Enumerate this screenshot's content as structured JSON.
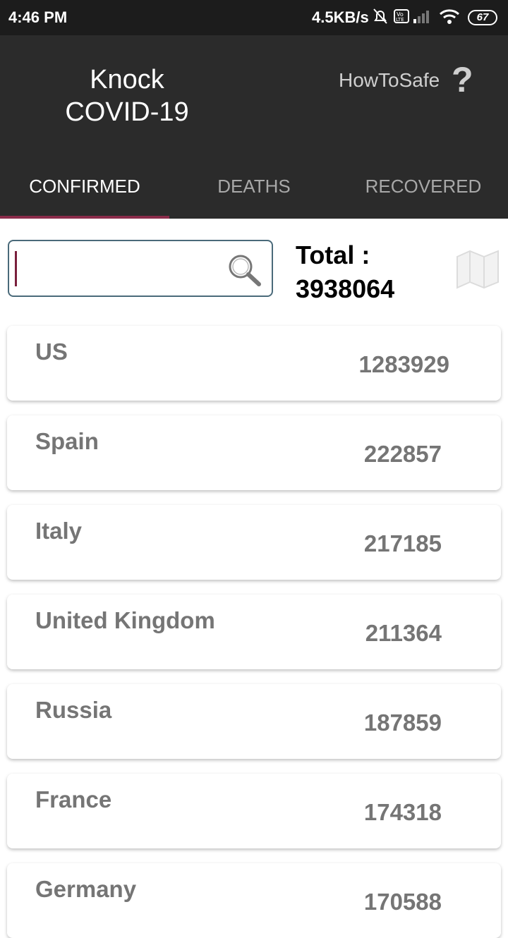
{
  "status_bar": {
    "time": "4:46 PM",
    "net_speed": "4.5KB/s",
    "battery": "67",
    "icons": [
      "mute-icon",
      "volte-icon",
      "signal-icon",
      "wifi-icon",
      "battery-icon"
    ]
  },
  "header": {
    "title_line1": "Knock",
    "title_line2": "COVID-19",
    "howto_label": "HowToSafe",
    "help_symbol": "?"
  },
  "tabs": [
    {
      "label": "CONFIRMED",
      "active": true
    },
    {
      "label": "DEATHS",
      "active": false
    },
    {
      "label": "RECOVERED",
      "active": false
    }
  ],
  "search": {
    "value": "",
    "placeholder": ""
  },
  "total": {
    "label": "Total :",
    "value": "3938064"
  },
  "countries": [
    {
      "name": "US",
      "count": "1283929"
    },
    {
      "name": "Spain",
      "count": "222857"
    },
    {
      "name": "Italy",
      "count": "217185"
    },
    {
      "name": "United Kingdom",
      "count": "211364"
    },
    {
      "name": "Russia",
      "count": "187859"
    },
    {
      "name": "France",
      "count": "174318"
    },
    {
      "name": "Germany",
      "count": "170588"
    }
  ],
  "colors": {
    "header_bg": "#2b2b2b",
    "status_bg": "#1c1c1c",
    "tab_indicator": "#8a2c4a",
    "card_text": "#757575"
  }
}
